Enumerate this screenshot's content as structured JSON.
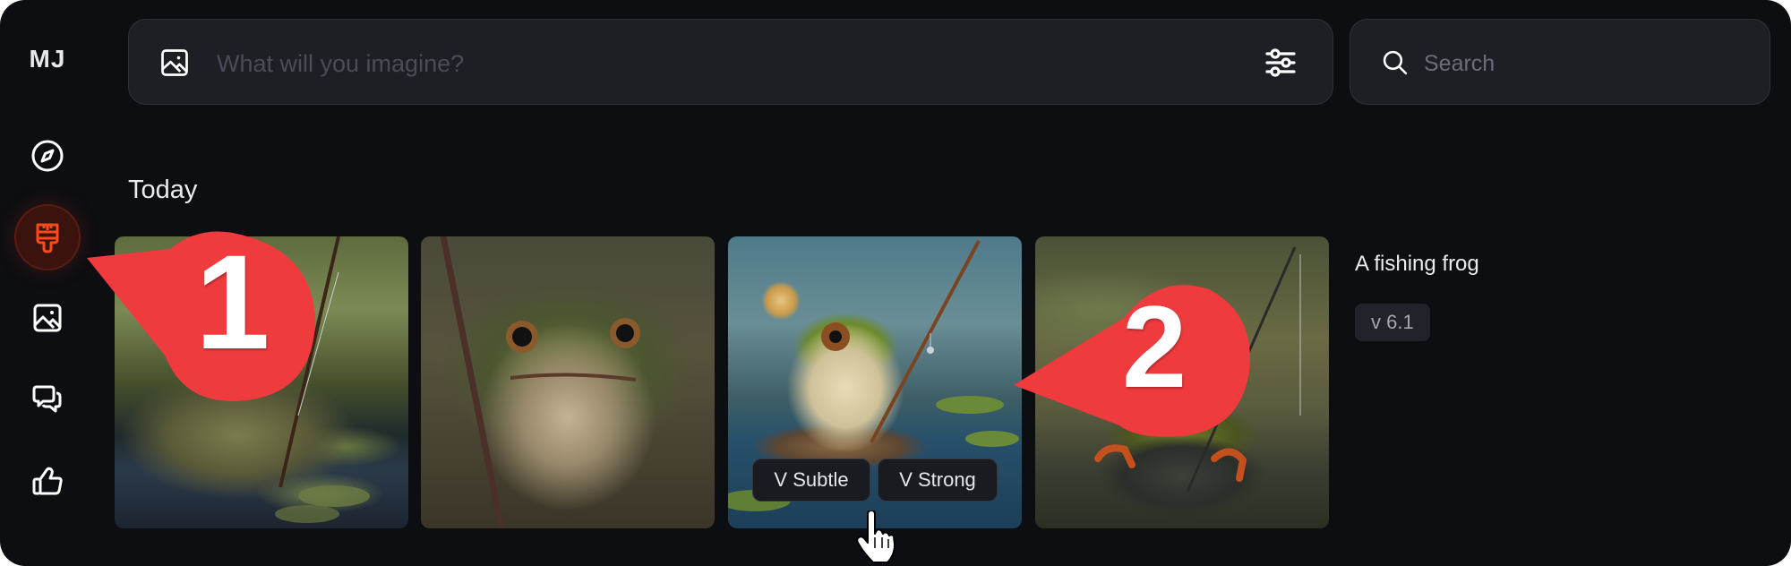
{
  "app": {
    "logo": "MJ",
    "colors": {
      "background": "#0d0e12",
      "panel": "#1e1f24",
      "accent": "#ff4a1c",
      "annotation": "#ef3b3e"
    }
  },
  "sidebar": {
    "items": [
      {
        "name": "explore",
        "icon": "compass-icon",
        "active": false
      },
      {
        "name": "create",
        "icon": "paintbrush-icon",
        "active": true
      },
      {
        "name": "organize",
        "icon": "image-icon",
        "active": false
      },
      {
        "name": "chat",
        "icon": "chat-bubbles-icon",
        "active": false
      },
      {
        "name": "rank",
        "icon": "thumbs-up-icon",
        "active": false
      }
    ]
  },
  "prompt_bar": {
    "placeholder": "What will you imagine?",
    "value": "",
    "left_icon": "image-icon",
    "right_icon": "sliders-icon"
  },
  "search": {
    "placeholder": "Search",
    "value": "",
    "icon": "search-icon"
  },
  "feed": {
    "section_title": "Today",
    "job": {
      "prompt": "A fishing frog",
      "version": "v 6.1",
      "images": [
        {
          "alt": "Oil painting of a frog fishing in a pond"
        },
        {
          "alt": "Oil painting close-up of a frog holding a fishing rod"
        },
        {
          "alt": "Painted frog sitting on a stump with a fishing rod near a lily"
        },
        {
          "alt": "Photo of a frog figurine on a rock with a fishing rod"
        }
      ],
      "hover_actions": {
        "subtle": "V Subtle",
        "strong": "V Strong"
      }
    }
  },
  "annotations": [
    {
      "label": "1",
      "target": "create sidebar item"
    },
    {
      "label": "2",
      "target": "V Strong button / third image"
    }
  ]
}
